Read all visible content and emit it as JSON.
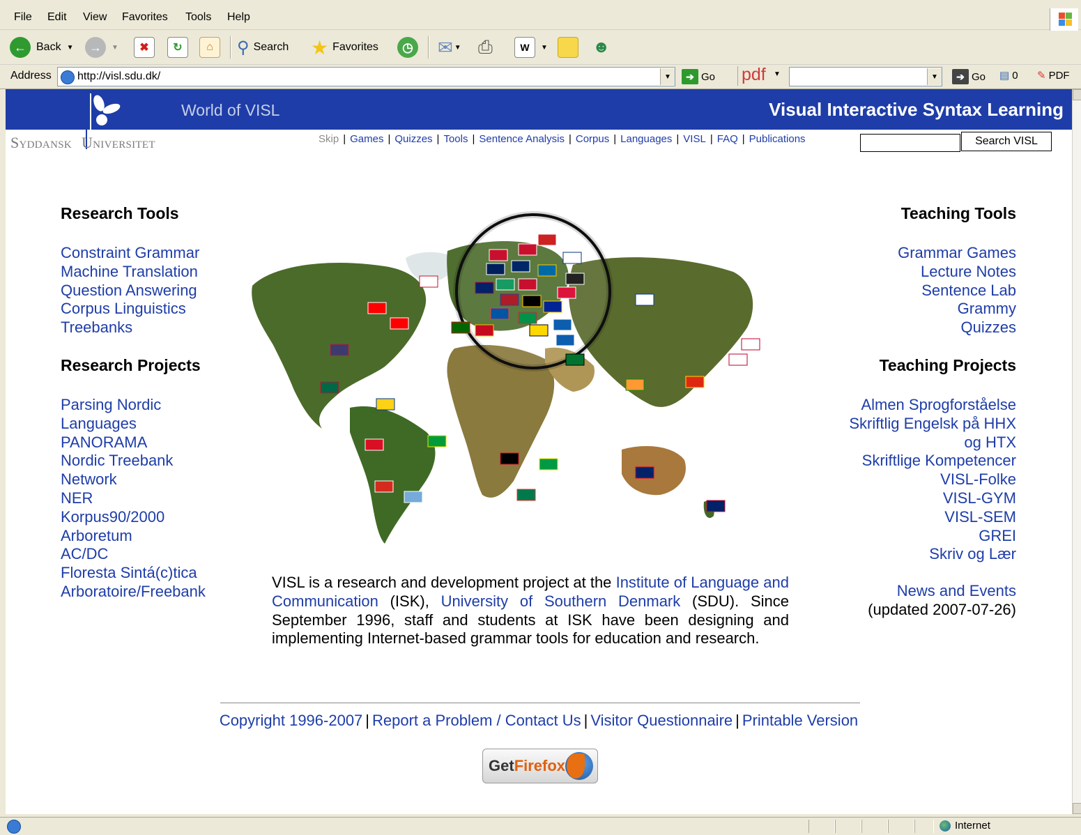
{
  "browser": {
    "menu": [
      "File",
      "Edit",
      "View",
      "Favorites",
      "Tools",
      "Help"
    ],
    "toolbar": {
      "back_label": "Back",
      "search_label": "Search",
      "favorites_label": "Favorites"
    },
    "address": {
      "label": "Address",
      "url": "http://visl.sdu.dk/",
      "go_label": "Go",
      "pdf_brand": "pdf",
      "go2_label": "Go",
      "counter": "0",
      "pdf_label": "PDF"
    },
    "status": {
      "zone": "Internet"
    }
  },
  "header": {
    "world_title": "World of VISL",
    "site_title": "Visual Interactive Syntax Learning",
    "university": {
      "part1": "Syddansk",
      "part2": "Universitet"
    },
    "nav": [
      "Skip",
      "Games",
      "Quizzes",
      "Tools",
      "Sentence Analysis",
      "Corpus",
      "Languages",
      "VISL",
      "FAQ",
      "Publications"
    ],
    "search_button": "Search VISL",
    "search_value": ""
  },
  "left": {
    "research_tools": {
      "heading": "Research Tools",
      "items": [
        "Constraint Grammar",
        "Machine Translation",
        "Question Answering",
        "Corpus Linguistics",
        "Treebanks"
      ]
    },
    "research_projects": {
      "heading": "Research Projects",
      "items": [
        "Parsing Nordic",
        "Languages",
        "PANORAMA",
        "Nordic Treebank",
        "Network",
        "NER",
        "Korpus90/2000",
        "Arboretum",
        "AC/DC",
        "Floresta Sintá(c)tica",
        "Arboratoire/Freebank"
      ]
    }
  },
  "right": {
    "teaching_tools": {
      "heading": "Teaching Tools",
      "items": [
        "Grammar Games",
        "Lecture Notes",
        "Sentence Lab",
        "Grammy",
        "Quizzes"
      ]
    },
    "teaching_projects": {
      "heading": "Teaching Projects",
      "items": [
        "Almen Sprogforståelse",
        "Skriftlig Engelsk på HHX",
        "og HTX",
        "Skriftlige Kompetencer",
        "VISL-Folke",
        "VISL-GYM",
        "VISL-SEM",
        "GREI",
        "Skriv og Lær"
      ]
    },
    "news": {
      "link": "News and Events",
      "updated": "(updated 2007-07-26)"
    }
  },
  "description": {
    "t1": "VISL is a research and development project at the ",
    "link1": "Institute of Language and Communication",
    "t2": " (ISK), ",
    "link2": "University of Southern Denmark",
    "t3": " (SDU). Since September 1996, staff and students at ISK have been designing and implementing Internet-based grammar tools for education and research."
  },
  "footer": {
    "copyright": "Copyright 1996-2007",
    "report": "Report a Problem / Contact Us",
    "questionnaire": "Visitor Questionnaire",
    "printable": "Printable Version",
    "firefox_get": "Get",
    "firefox_name": "Firefox"
  },
  "colors": {
    "banner": "#1e3da8",
    "link": "#1e3da8"
  }
}
